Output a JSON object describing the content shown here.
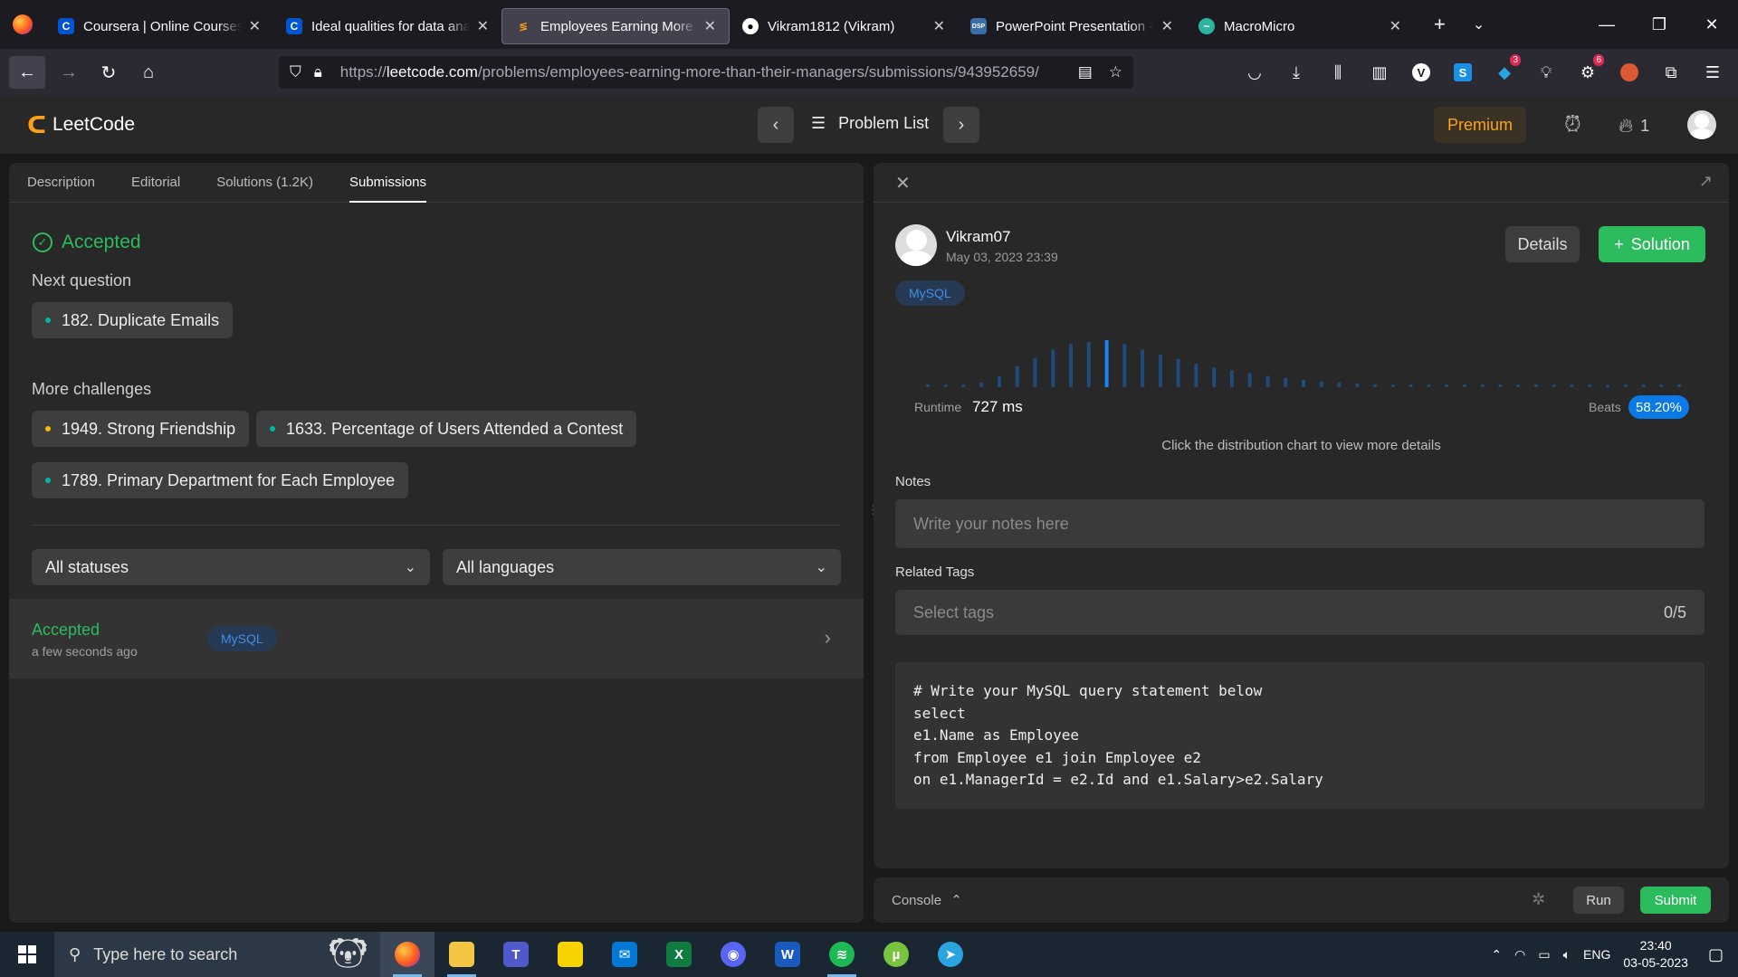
{
  "browser": {
    "tabs": [
      {
        "title": "Coursera | Online Courses & Credentials",
        "favicon": "coursera-icon",
        "active": false
      },
      {
        "title": "Ideal qualities for data analysts",
        "favicon": "coursera-icon",
        "active": false
      },
      {
        "title": "Employees Earning More Than Their Managers",
        "favicon": "leetcode-icon",
        "active": true
      },
      {
        "title": "Vikram1812 (Vikram)",
        "favicon": "github-icon",
        "active": false
      },
      {
        "title": "PowerPoint Presentation - new",
        "favicon": "dsp-icon",
        "active": false
      },
      {
        "title": "MacroMicro",
        "favicon": "macromicro-icon",
        "active": false
      }
    ],
    "url_prefix": "https://",
    "url_domain": "leetcode.com",
    "url_path": "/problems/employees-earning-more-than-their-managers/submissions/943952659/",
    "badges": {
      "extension_a": "3",
      "extension_b": "6"
    }
  },
  "header": {
    "logo_text": "LeetCode",
    "problem_list_label": "Problem List",
    "premium_label": "Premium",
    "streak_count": "1"
  },
  "left": {
    "tabs": [
      "Description",
      "Editorial",
      "Solutions (1.2K)",
      "Submissions"
    ],
    "accepted_title": "Accepted",
    "next_question_label": "Next question",
    "next_question": "182. Duplicate Emails",
    "more_challenges_label": "More challenges",
    "challenges": [
      {
        "label": "1949. Strong Friendship",
        "dot_color": "#ffb800"
      },
      {
        "label": "1633. Percentage of Users Attended a Contest",
        "dot_color": "#00b8a3"
      },
      {
        "label": "1789. Primary Department for Each Employee",
        "dot_color": "#00b8a3"
      }
    ],
    "status_filter": "All statuses",
    "language_filter": "All languages",
    "submission": {
      "status": "Accepted",
      "time": "a few seconds ago",
      "language": "MySQL"
    }
  },
  "right": {
    "user_name": "Vikram07",
    "date": "May 03, 2023 23:39",
    "details_label": "Details",
    "solution_label": "Solution",
    "language": "MySQL",
    "runtime_label": "Runtime",
    "runtime_value": "727 ms",
    "beats_label": "Beats",
    "beats_value": "58.20%",
    "chart_hint": "Click the distribution chart to view more details",
    "notes_label": "Notes",
    "notes_placeholder": "Write your notes here",
    "tags_label": "Related Tags",
    "tags_placeholder": "Select tags",
    "tags_count": "0/5",
    "code": "# Write your MySQL query statement below\nselect\ne1.Name as Employee\nfrom Employee e1 join Employee e2\non e1.ManagerId = e2.Id and e1.Salary>e2.Salary",
    "distribution": [
      0.03,
      0.03,
      0.05,
      0.1,
      0.24,
      0.45,
      0.62,
      0.8,
      0.92,
      0.96,
      1.0,
      0.92,
      0.8,
      0.7,
      0.6,
      0.5,
      0.42,
      0.36,
      0.3,
      0.24,
      0.2,
      0.16,
      0.12,
      0.1,
      0.08,
      0.06,
      0.05,
      0.05,
      0.05,
      0.05,
      0.05,
      0.05,
      0.05,
      0.05,
      0.05,
      0.05,
      0.05,
      0.05,
      0.05,
      0.05,
      0.05,
      0.05,
      0.05
    ],
    "highlight_index": 10
  },
  "console": {
    "label": "Console",
    "run_label": "Run",
    "submit_label": "Submit"
  },
  "taskbar": {
    "search_placeholder": "Type here to search",
    "language": "ENG",
    "time": "23:40",
    "date": "03-05-2023"
  },
  "colors": {
    "accepted_green": "#2cbb5d",
    "premium_orange": "#ffa116",
    "beats_blue": "#0b79e6",
    "bar_dim": "#1f4a7a",
    "bar_highlight": "#1a84f5"
  }
}
